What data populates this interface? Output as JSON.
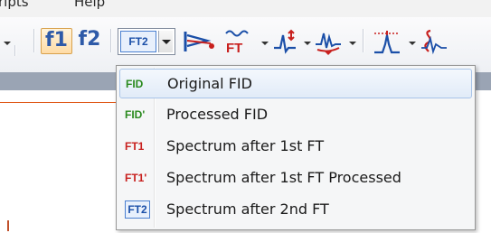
{
  "menubar": {
    "item_1": "ripts",
    "item_2": "Help"
  },
  "toolbar": {
    "f1_label": "f1",
    "f2_label": "f2",
    "selector_value": "FT2",
    "icons": [
      "plot-fid-icon",
      "fourier-transform-icon",
      "phase-correction-icon",
      "baseline-correction-icon",
      "peak-picking-icon",
      "integration-icon"
    ]
  },
  "menu": {
    "items": [
      {
        "icon_text": "FID",
        "icon_color": "#2a8a1e",
        "label": "Original FID"
      },
      {
        "icon_text": "FID'",
        "icon_color": "#2a8a1e",
        "label": "Processed FID"
      },
      {
        "icon_text": "FT1",
        "icon_color": "#c8201e",
        "label": "Spectrum after 1st FT"
      },
      {
        "icon_text": "FT1'",
        "icon_color": "#c8201e",
        "label": "Spectrum after 1st FT Processed"
      },
      {
        "icon_text": "FT2",
        "icon_color": "#1b4fa8",
        "label": "Spectrum after 2nd FT"
      }
    ],
    "highlighted_index": 0
  },
  "colors": {
    "accent_orange": "#ffdca6",
    "selection_blue": "#a8c4e8",
    "band_gray": "#9aa4b4"
  }
}
